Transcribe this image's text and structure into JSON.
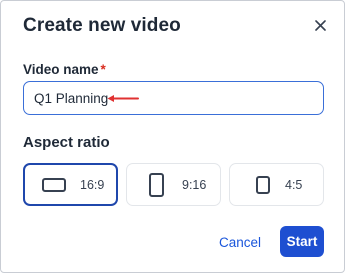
{
  "dialog": {
    "title": "Create new video",
    "close_icon": "close-icon"
  },
  "video_name": {
    "label": "Video name",
    "required_marker": "*",
    "value": "Q1 Planning",
    "annotation_icon": "red-arrow-left-icon"
  },
  "aspect_ratio": {
    "label": "Aspect ratio",
    "options": [
      {
        "label": "16:9",
        "icon": "landscape-rectangle-icon",
        "selected": true
      },
      {
        "label": "9:16",
        "icon": "portrait-rectangle-icon",
        "selected": false
      },
      {
        "label": "4:5",
        "icon": "portrait-rectangle-icon",
        "selected": false
      }
    ]
  },
  "actions": {
    "cancel_label": "Cancel",
    "start_label": "Start"
  },
  "colors": {
    "primary": "#1e4fd1",
    "selected_border": "#1f47ac",
    "input_focus": "#3a6fd8",
    "required": "#d92d20",
    "annotation": "#e03131"
  }
}
